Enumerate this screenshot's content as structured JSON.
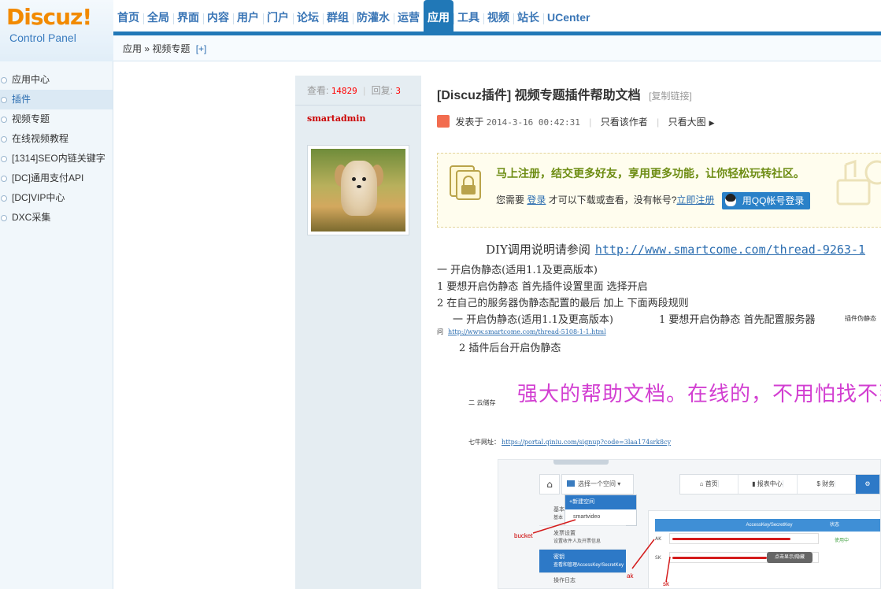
{
  "logo": {
    "main": "Discuz!",
    "sub": "Control Panel"
  },
  "topnav": [
    {
      "label": "首页",
      "active": false
    },
    {
      "label": "全局",
      "active": false
    },
    {
      "label": "界面",
      "active": false
    },
    {
      "label": "内容",
      "active": false
    },
    {
      "label": "用户",
      "active": false
    },
    {
      "label": "门户",
      "active": false
    },
    {
      "label": "论坛",
      "active": false
    },
    {
      "label": "群组",
      "active": false
    },
    {
      "label": "防灌水",
      "active": false
    },
    {
      "label": "运营",
      "active": false
    },
    {
      "label": "应用",
      "active": true
    },
    {
      "label": "工具",
      "active": false
    },
    {
      "label": "视频",
      "active": false
    },
    {
      "label": "站长",
      "active": false
    },
    {
      "label": "UCenter",
      "active": false
    }
  ],
  "breadcrumb": {
    "text": "应用 » 视频专题",
    "add": "[+]"
  },
  "sidebar": {
    "items": [
      {
        "label": "应用中心"
      },
      {
        "label": "插件"
      },
      {
        "label": "视频专题"
      },
      {
        "label": "在线视频教程"
      },
      {
        "label": "[1314]SEO内链关键字"
      },
      {
        "label": "[DC]通用支付API"
      },
      {
        "label": "[DC]VIP中心"
      },
      {
        "label": "DXC采集"
      }
    ],
    "active_index": 1
  },
  "thread": {
    "views_label": "查看:",
    "views": "14829",
    "replies_label": "回复:",
    "replies": "3",
    "author": "smartadmin",
    "title": "[Discuz插件] 视频专题插件帮助文档",
    "copy_link": "[复制链接]",
    "posted_label": "发表于",
    "posted_date": "2014-3-16 00:42:31",
    "only_author": "只看该作者",
    "only_big_image": "只看大图"
  },
  "login_prompt": {
    "headline": "马上注册，结交更多好友，享用更多功能，让你轻松玩转社区。",
    "need": "您需要",
    "login_link": "登录",
    "middle": "才可以下载或查看，没有帐号?",
    "register_link": "立即注册",
    "qq_button": "用QQ帐号登录"
  },
  "body": {
    "diy_text": "DIY调用说明请参阅",
    "diy_link": "http://www.smartcome.com/thread-9263-1",
    "line1": "一 开启伪静态(适用1.1及更高版本)",
    "line2": "1 要想开启伪静态 首先插件设置里面 选择开启",
    "line3": "2 在自己的服务器伪静态配置的最后 加上 下面两段规则",
    "line4": "一 开启伪静态(适用1.1及更高版本)",
    "line4b": "1 要想开启伪静态 首先配置服务器",
    "line4c": "插件伪静态",
    "line5_prefix": "问",
    "line5_link": "http://www.smartcome.com/thread-5108-1-1.html",
    "line6": "2 插件后台开启伪静态",
    "overlay": "强大的帮助文档。在线的，不用怕找不到！",
    "line7": "二 云储存",
    "line8_label": "七牛网址：",
    "line8_link": "https://portal.qiniu.com/signup?code=3laa174srk8cy"
  },
  "qiniu_shot": {
    "space_select": "选择一个空间",
    "new_space": "+新建空间",
    "space_item": "smartvideo",
    "nav": [
      "首页",
      "报表中心",
      "财务"
    ],
    "left_rows": [
      {
        "title": "基本",
        "small": "基本"
      },
      {
        "title": "发票设置",
        "small": "设置收件人及开票信息"
      },
      {
        "title": "密钥",
        "small": "查看和管理AccessKey/SecretKey"
      },
      {
        "title": "操作日志",
        "small": ""
      }
    ],
    "panel_header": "AccessKey/SecretKey",
    "panel_header2": "状态",
    "ak_label": "AK",
    "sk_label": "SK",
    "show_button": "点击显示/隐藏",
    "status": "使用中",
    "annotations": [
      "bucket",
      "ak",
      "sk"
    ]
  },
  "colors": {
    "brand_blue": "#2178b7",
    "logo_orange": "#f28a00",
    "overlay_magenta": "#d23ed1",
    "headline_green": "#6e8d14"
  }
}
